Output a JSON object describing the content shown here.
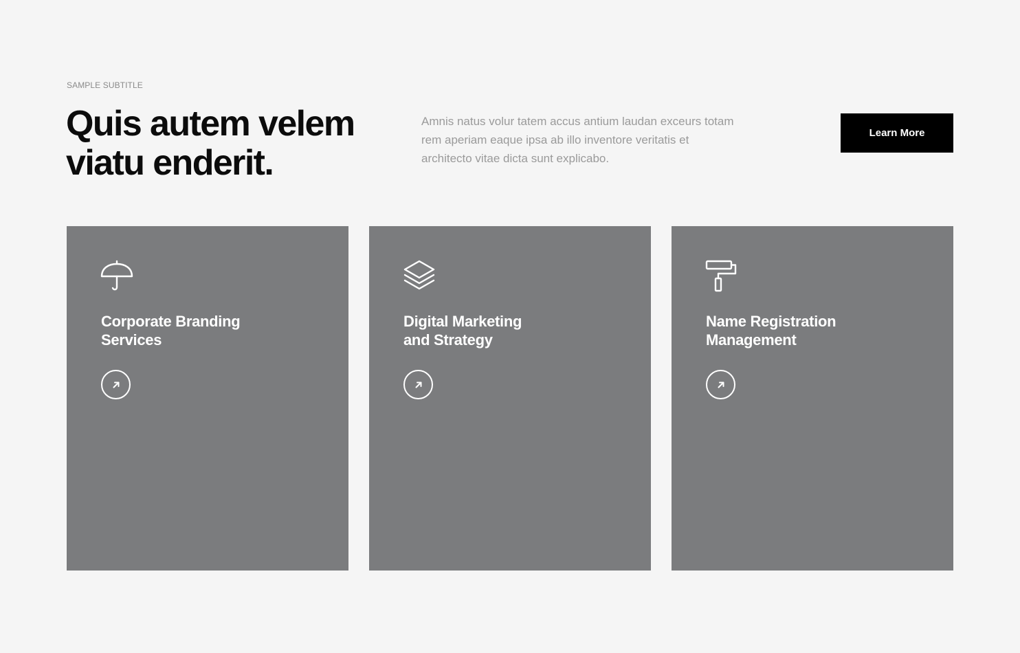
{
  "header": {
    "subtitle": "SAMPLE SUBTITLE",
    "title_line_1": "Quis autem velem",
    "title_line_2": "viatu enderit.",
    "intro_line_1": "Amnis natus volur tatem accus antium laudan exceurs totam",
    "intro_line_2": "rem aperiam eaque ipsa ab illo inventore veritatis et",
    "intro_line_3": "architecto vitae dicta sunt explicabo.",
    "button_label": "Learn More"
  },
  "services": [
    {
      "icon": "umbrella-icon",
      "title_line_1": "Corporate Branding",
      "title_line_2": "Services",
      "link_icon": "arrow-up-right-icon"
    },
    {
      "icon": "layers-icon",
      "title_line_1": "Digital Marketing",
      "title_line_2": "and Strategy",
      "link_icon": "arrow-up-right-icon"
    },
    {
      "icon": "paint-roller-icon",
      "title_line_1": "Name Registration",
      "title_line_2": "Management",
      "link_icon": "arrow-up-right-icon"
    }
  ],
  "colors": {
    "page_background": "#f5f5f5",
    "card_background": "#7b7c7e",
    "button_background": "#000000",
    "heading_text": "#0c0c0c",
    "muted_text": "#9a9a9a",
    "card_text": "#ffffff"
  }
}
